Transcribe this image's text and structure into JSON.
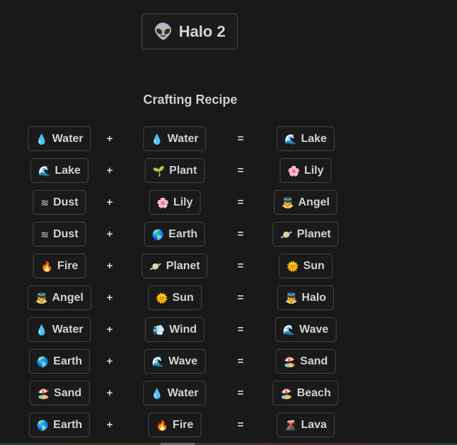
{
  "header": {
    "title": "Halo 2",
    "title_icon": "👽",
    "title_icon_name": "alien-icon"
  },
  "section": {
    "heading": "Crafting Recipe"
  },
  "operators": {
    "plus": "+",
    "equals": "="
  },
  "recipes": [
    {
      "a": {
        "icon": "💧",
        "label": "Water"
      },
      "b": {
        "icon": "💧",
        "label": "Water"
      },
      "result": {
        "icon": "🌊",
        "label": "Lake"
      }
    },
    {
      "a": {
        "icon": "🌊",
        "label": "Lake"
      },
      "b": {
        "icon": "🌱",
        "label": "Plant"
      },
      "result": {
        "icon": "🌸",
        "label": "Lily"
      }
    },
    {
      "a": {
        "icon": "≋",
        "label": "Dust"
      },
      "b": {
        "icon": "🌸",
        "label": "Lily"
      },
      "result": {
        "icon": "👼",
        "label": "Angel"
      }
    },
    {
      "a": {
        "icon": "≋",
        "label": "Dust"
      },
      "b": {
        "icon": "🌎",
        "label": "Earth"
      },
      "result": {
        "icon": "🪐",
        "label": "Planet"
      }
    },
    {
      "a": {
        "icon": "🔥",
        "label": "Fire"
      },
      "b": {
        "icon": "🪐",
        "label": "Planet"
      },
      "result": {
        "icon": "🌞",
        "label": "Sun"
      }
    },
    {
      "a": {
        "icon": "👼",
        "label": "Angel"
      },
      "b": {
        "icon": "🌞",
        "label": "Sun"
      },
      "result": {
        "icon": "👼",
        "label": "Halo"
      }
    },
    {
      "a": {
        "icon": "💧",
        "label": "Water"
      },
      "b": {
        "icon": "💨",
        "label": "Wind"
      },
      "result": {
        "icon": "🌊",
        "label": "Wave"
      }
    },
    {
      "a": {
        "icon": "🌎",
        "label": "Earth"
      },
      "b": {
        "icon": "🌊",
        "label": "Wave"
      },
      "result": {
        "icon": "🏖️",
        "label": "Sand"
      }
    },
    {
      "a": {
        "icon": "🏖️",
        "label": "Sand"
      },
      "b": {
        "icon": "💧",
        "label": "Water"
      },
      "result": {
        "icon": "🏖️",
        "label": "Beach"
      }
    },
    {
      "a": {
        "icon": "🌎",
        "label": "Earth"
      },
      "b": {
        "icon": "🔥",
        "label": "Fire"
      },
      "result": {
        "icon": "🌋",
        "label": "Lava"
      }
    }
  ]
}
